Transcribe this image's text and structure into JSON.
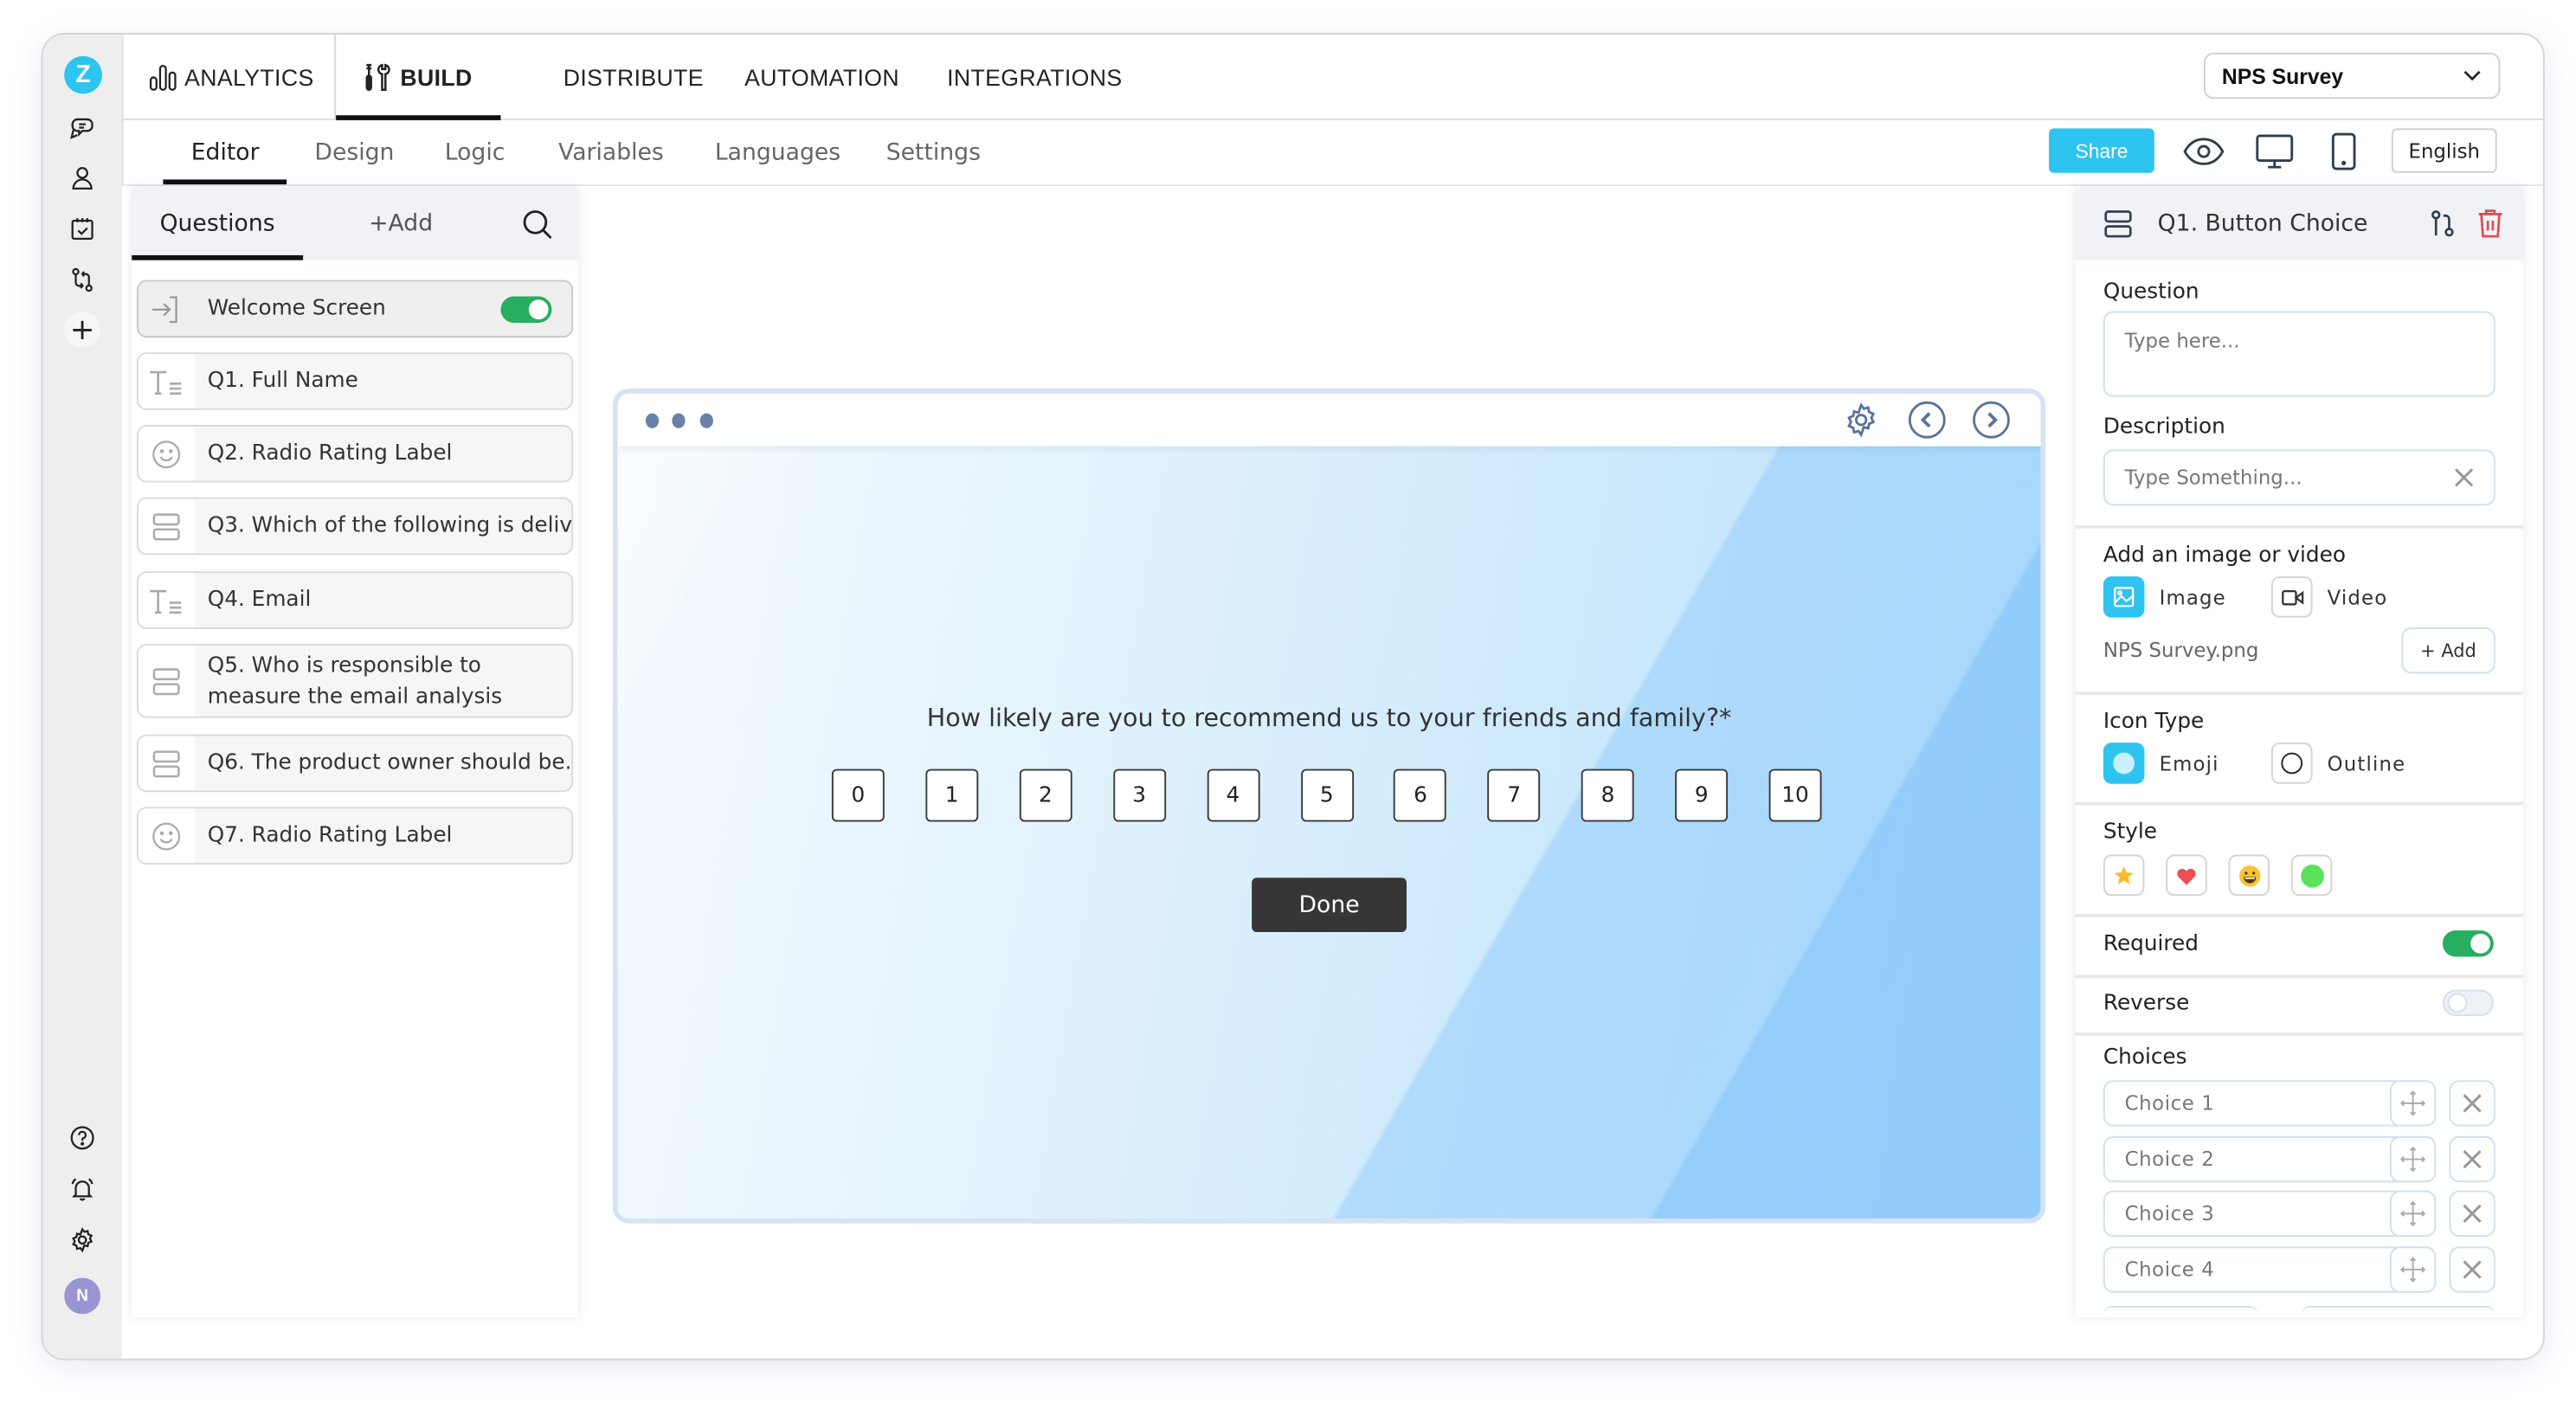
{
  "rail": {
    "logo_letter": "Z",
    "icons": [
      "chat-icon",
      "user-icon",
      "calendar-check-icon",
      "workflow-icon",
      "plus-icon"
    ],
    "bottom_icons": [
      "help-icon",
      "bell-icon",
      "gear-icon"
    ],
    "avatar_initial": "N"
  },
  "topnav": {
    "items": [
      {
        "label": "ANALYTICS",
        "icon": "bar-chart-icon",
        "active": false
      },
      {
        "label": "BUILD",
        "icon": "tools-icon",
        "active": true
      },
      {
        "label": "DISTRIBUTE",
        "active": false
      },
      {
        "label": "AUTOMATION",
        "active": false
      },
      {
        "label": "INTEGRATIONS",
        "active": false
      }
    ],
    "survey_select": "NPS Survey"
  },
  "subnav": {
    "tabs": [
      {
        "label": "Editor",
        "active": true
      },
      {
        "label": "Design",
        "active": false
      },
      {
        "label": "Logic",
        "active": false
      },
      {
        "label": "Variables",
        "active": false
      },
      {
        "label": "Languages",
        "active": false
      },
      {
        "label": "Settings",
        "active": false
      }
    ],
    "share_label": "Share",
    "language_label": "English"
  },
  "left_panel": {
    "tab_questions": "Questions",
    "tab_add": "+Add",
    "welcome": {
      "label": "Welcome Screen",
      "enabled": true
    },
    "questions": [
      {
        "label": "Q1. Full Name",
        "icon": "text-icon"
      },
      {
        "label": "Q2. Radio Rating Label",
        "icon": "smiley-icon"
      },
      {
        "label": "Q3. Which of the following is deliv...",
        "icon": "choice-icon"
      },
      {
        "label": "Q4. Email",
        "icon": "text-icon"
      },
      {
        "label": "Q5. Who is responsible to measure the email analysis",
        "icon": "choice-icon"
      },
      {
        "label": "Q6. The product owner should be...",
        "icon": "choice-icon"
      },
      {
        "label": "Q7. Radio Rating Label",
        "icon": "smiley-icon"
      }
    ]
  },
  "preview": {
    "question": "How likely are you to recommend us to your friends and family?*",
    "scale": [
      "0",
      "1",
      "2",
      "3",
      "4",
      "5",
      "6",
      "7",
      "8",
      "9",
      "10"
    ],
    "done_label": "Done"
  },
  "right_panel": {
    "title": "Q1. Button Choice",
    "question_label": "Question",
    "question_placeholder": "Type here...",
    "description_label": "Description",
    "description_placeholder": "Type Something...",
    "media_label": "Add an image or video",
    "media_image": "Image",
    "media_video": "Video",
    "media_selected": "image",
    "media_file": "NPS Survey.png",
    "media_add": "+ Add",
    "icon_type_label": "Icon Type",
    "icon_type_emoji": "Emoji",
    "icon_type_outline": "Outline",
    "icon_type_selected": "emoji",
    "style_label": "Style",
    "styles": [
      "star",
      "heart",
      "smiley",
      "dot"
    ],
    "required_label": "Required",
    "required": true,
    "reverse_label": "Reverse",
    "reverse": false,
    "choices_label": "Choices",
    "choices": [
      "Choice 1",
      "Choice 2",
      "Choice 3",
      "Choice 4"
    ]
  },
  "colors": {
    "accent": "#2ec4f0",
    "toggle_on": "#27ae60",
    "delete": "#e5484d",
    "done_bg": "#363636",
    "avatar": "#9a94d2"
  }
}
